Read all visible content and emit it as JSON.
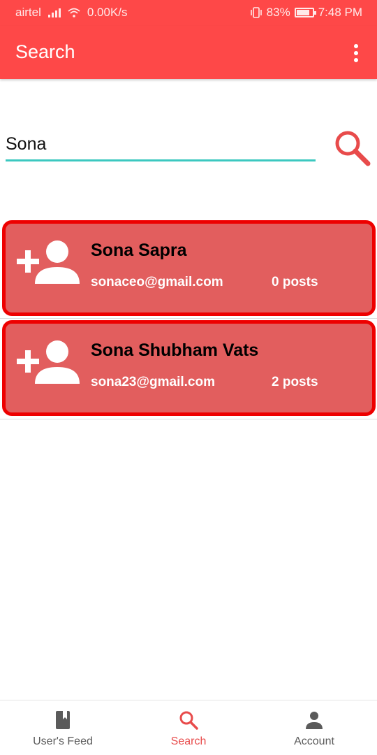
{
  "status_bar": {
    "carrier": "airtel",
    "net_speed": "0.00K/s",
    "battery_percent": "83%",
    "battery_level": 0.83,
    "time": "7:48 PM"
  },
  "app_bar": {
    "title": "Search",
    "menu_icon": "more-vert-icon"
  },
  "search": {
    "value": "Sona",
    "placeholder": "",
    "button_icon": "search-icon"
  },
  "results": [
    {
      "name": "Sona Sapra",
      "email": "sonaceo@gmail.com",
      "posts": "0 posts",
      "icon": "add-user-icon"
    },
    {
      "name": "Sona Shubham Vats",
      "email": "sona23@gmail.com",
      "posts": "2 posts",
      "icon": "add-user-icon"
    }
  ],
  "bottom_nav": {
    "items": [
      {
        "label": "User's Feed",
        "icon": "book-icon",
        "active": false
      },
      {
        "label": "Search",
        "icon": "search-icon",
        "active": true
      },
      {
        "label": "Account",
        "icon": "person-icon",
        "active": false
      }
    ]
  },
  "colors": {
    "primary": "#fe4848",
    "card_background": "#e25e5e",
    "card_border": "#ee0000",
    "input_underline": "#3cc8c0",
    "nav_active": "#e84b4b",
    "nav_inactive": "#5b5b5b"
  }
}
